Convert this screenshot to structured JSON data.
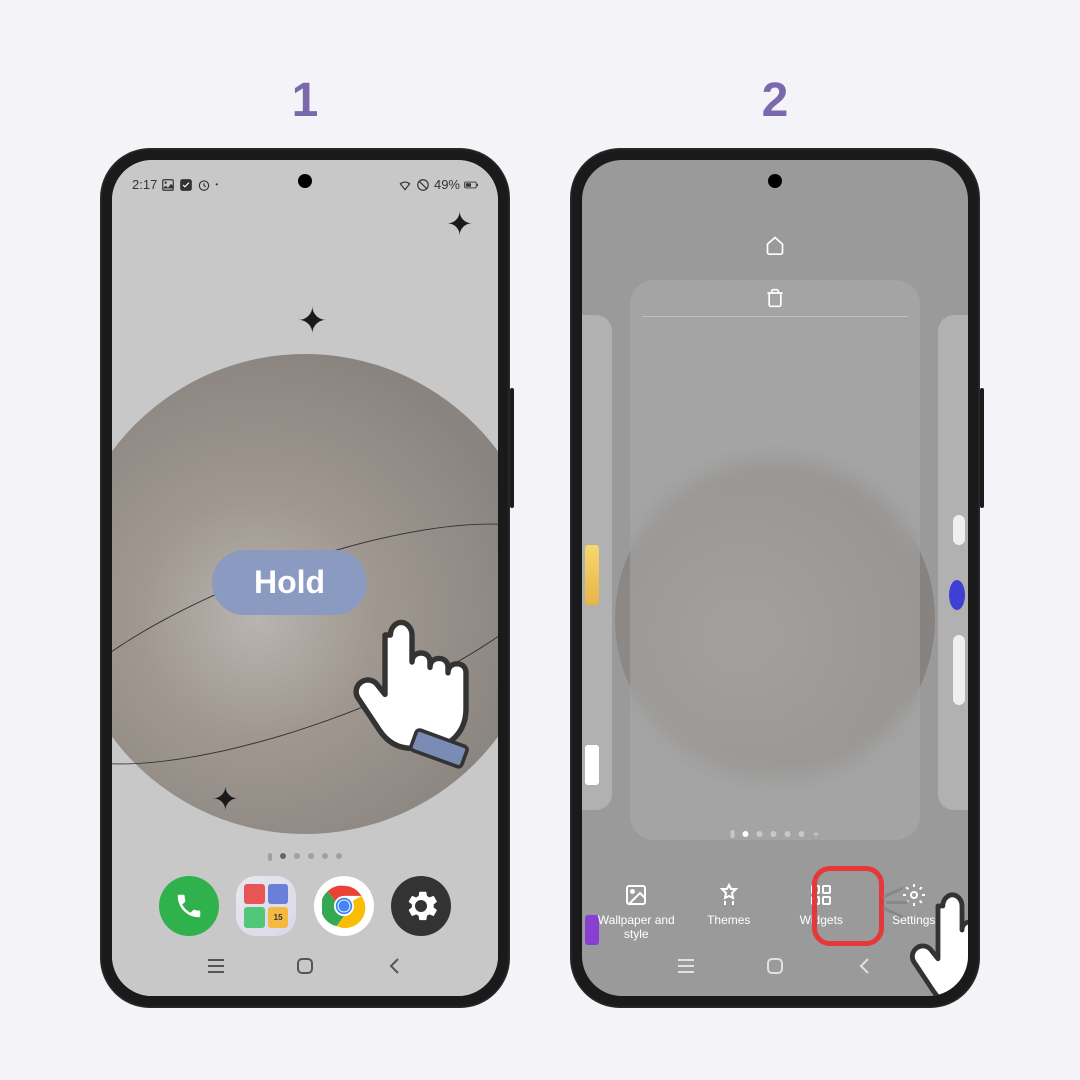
{
  "steps": {
    "1": "1",
    "2": "2"
  },
  "status": {
    "time": "2:17",
    "battery": "49%"
  },
  "hold_label": "Hold",
  "edit_options": {
    "wallpaper": "Wallpaper and style",
    "themes": "Themes",
    "widgets": "Widgets",
    "settings": "Settings"
  },
  "grid_badge": "15"
}
